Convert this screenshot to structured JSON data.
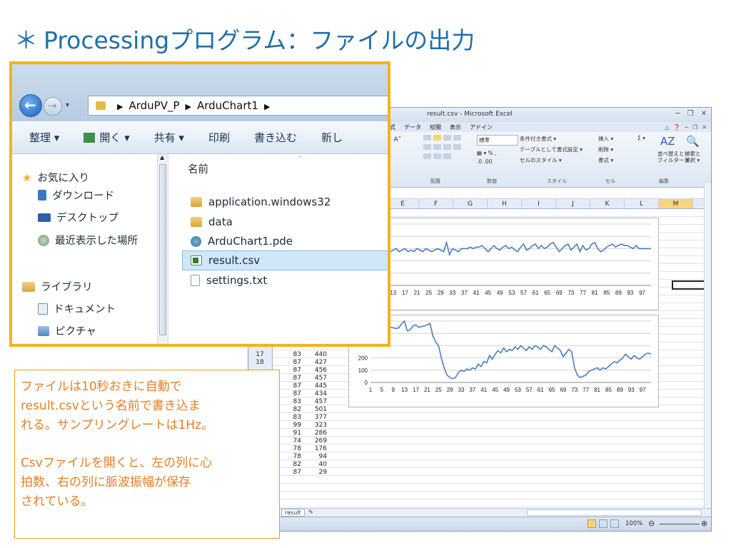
{
  "slide": {
    "title_prefix": "＊",
    "title": "Processingプログラム：ファイルの出力"
  },
  "explorer": {
    "breadcrumb": [
      "ArduPV_P",
      "ArduChart1"
    ],
    "toolbar": [
      "整理 ▾",
      "開く ▾",
      "共有 ▾",
      "印刷",
      "書き込む",
      "新し"
    ],
    "nav": {
      "favorites": "お気に入り",
      "downloads": "ダウンロード",
      "desktop": "デスクトップ",
      "recent": "最近表示した場所",
      "libraries": "ライブラリ",
      "documents": "ドキュメント",
      "pictures": "ピクチャ"
    },
    "column_header": "名前",
    "files": [
      {
        "name": "application.windows32",
        "icon": "folder-icon"
      },
      {
        "name": "data",
        "icon": "folder-icon"
      },
      {
        "name": "ArduChart1.pde",
        "icon": "processing-file-icon"
      },
      {
        "name": "result.csv",
        "icon": "csv-file-icon",
        "selected": true
      },
      {
        "name": "settings.txt",
        "icon": "text-file-icon"
      }
    ]
  },
  "excel": {
    "caption": "result.csv - Microsoft Excel",
    "tabs": [
      "数式",
      "データ",
      "校閲",
      "表示",
      "アドイン"
    ],
    "ribbon": {
      "number_format": "標準",
      "cond_format": "条件付き書式 ▾",
      "table_format": "テーブルとして書式設定 ▾",
      "cell_style": "セルのスタイル ▾",
      "insert": "挿入 ▾",
      "delete": "削除 ▾",
      "format": "書式 ▾",
      "sort": "並べ替えと\nフィルター ▾",
      "find": "検索と\n選択 ▾",
      "groups": [
        "配置",
        "数値",
        "スタイル",
        "セル",
        "編集"
      ]
    },
    "columns": [
      "E",
      "F",
      "G",
      "H",
      "I",
      "J",
      "K",
      "L",
      "M"
    ],
    "rows": [
      {
        "n": "17",
        "a": "83",
        "b": "440"
      },
      {
        "n": "18",
        "a": "87",
        "b": "427"
      },
      {
        "n": "",
        "a": "87",
        "b": "456"
      },
      {
        "n": "",
        "a": "87",
        "b": "457"
      },
      {
        "n": "",
        "a": "87",
        "b": "445"
      },
      {
        "n": "",
        "a": "87",
        "b": "434"
      },
      {
        "n": "",
        "a": "83",
        "b": "457"
      },
      {
        "n": "",
        "a": "82",
        "b": "501"
      },
      {
        "n": "",
        "a": "83",
        "b": "377"
      },
      {
        "n": "",
        "a": "99",
        "b": "323"
      },
      {
        "n": "",
        "a": "91",
        "b": "286"
      },
      {
        "n": "",
        "a": "74",
        "b": "269"
      },
      {
        "n": "",
        "a": "78",
        "b": "176"
      },
      {
        "n": "",
        "a": "78",
        "b": "94"
      },
      {
        "n": "",
        "a": "82",
        "b": "40"
      },
      {
        "n": "",
        "a": "87",
        "b": "29"
      }
    ],
    "sheet_tab": "result",
    "zoom": "100%",
    "chart_xticks": [
      "1",
      "5",
      "9",
      "13",
      "17",
      "21",
      "25",
      "29",
      "33",
      "37",
      "41",
      "45",
      "49",
      "53",
      "57",
      "61",
      "65",
      "69",
      "73",
      "77",
      "81",
      "85",
      "89",
      "93",
      "97"
    ],
    "chart_xticks_top": [
      "9",
      "13",
      "17",
      "21",
      "25",
      "29",
      "33",
      "37",
      "41",
      "45",
      "49",
      "53",
      "57",
      "61",
      "65",
      "69",
      "73",
      "77",
      "81",
      "85",
      "89",
      "93",
      "97"
    ],
    "chart2_yticks": [
      "0",
      "100",
      "200"
    ]
  },
  "chart_data": [
    {
      "type": "line",
      "x": [
        1,
        2,
        3,
        4,
        5,
        6,
        7,
        8,
        9,
        10,
        11,
        12,
        13,
        14,
        15,
        16,
        17,
        18,
        19,
        20,
        21,
        22,
        23,
        24,
        25,
        26,
        27,
        28,
        29,
        30,
        31,
        32,
        33,
        34,
        35,
        36,
        37,
        38,
        39,
        40,
        41,
        42,
        43,
        44,
        45,
        46,
        47,
        48,
        49,
        50,
        51,
        52,
        53,
        54,
        55,
        56,
        57,
        58,
        59,
        60,
        61,
        62,
        63,
        64,
        65,
        66,
        67,
        68,
        69,
        70,
        71,
        72,
        73,
        74,
        75,
        76,
        77,
        78,
        79,
        80,
        81,
        82,
        83,
        84,
        85,
        86,
        87,
        88,
        89,
        90,
        91,
        92,
        93,
        94,
        95,
        96,
        97,
        98,
        99,
        100
      ],
      "values": [
        82,
        83,
        84,
        82,
        84,
        83,
        82,
        84,
        83,
        82,
        81,
        82,
        83,
        84,
        82,
        83,
        84,
        82,
        83,
        82,
        84,
        83,
        82,
        84,
        83,
        82,
        83,
        84,
        83,
        82,
        88,
        80,
        84,
        83,
        82,
        84,
        84,
        84,
        85,
        84,
        85,
        85,
        86,
        84,
        82,
        84,
        86,
        84,
        83,
        85,
        86,
        84,
        85,
        83,
        82,
        85,
        87,
        83,
        84,
        86,
        87,
        84,
        86,
        84,
        85,
        87,
        88,
        85,
        82,
        84,
        86,
        87,
        83,
        85,
        87,
        82,
        86,
        83,
        84,
        87,
        88,
        84,
        82,
        83,
        85,
        86,
        87,
        85,
        86,
        87,
        86,
        86,
        85,
        84,
        86,
        84,
        84,
        84,
        84,
        84
      ],
      "xlabel": "",
      "ylabel": ""
    },
    {
      "type": "line",
      "x": [
        1,
        2,
        3,
        4,
        5,
        6,
        7,
        8,
        9,
        10,
        11,
        12,
        13,
        14,
        15,
        16,
        17,
        18,
        19,
        20,
        21,
        22,
        23,
        24,
        25,
        26,
        27,
        28,
        29,
        30,
        31,
        32,
        33,
        34,
        35,
        36,
        37,
        38,
        39,
        40,
        41,
        42,
        43,
        44,
        45,
        46,
        47,
        48,
        49,
        50,
        51,
        52,
        53,
        54,
        55,
        56,
        57,
        58,
        59,
        60,
        61,
        62,
        63,
        64,
        65,
        66,
        67,
        68,
        69,
        70,
        71,
        72,
        73,
        74,
        75,
        76,
        77,
        78,
        79,
        80,
        81,
        82,
        83,
        84,
        85,
        86,
        87,
        88,
        89,
        90,
        91,
        92,
        93,
        94,
        95,
        96,
        97,
        98,
        99,
        100
      ],
      "values": [
        520,
        500,
        480,
        510,
        440,
        430,
        440,
        450,
        445,
        440,
        445,
        480,
        500,
        420,
        430,
        460,
        470,
        450,
        455,
        460,
        470,
        480,
        380,
        330,
        300,
        200,
        120,
        60,
        40,
        30,
        40,
        80,
        100,
        90,
        110,
        100,
        120,
        110,
        150,
        130,
        170,
        160,
        220,
        190,
        230,
        260,
        240,
        280,
        250,
        270,
        260,
        290,
        270,
        300,
        280,
        260,
        290,
        270,
        300,
        290,
        270,
        300,
        290,
        270,
        250,
        300,
        280,
        260,
        210,
        240,
        270,
        250,
        120,
        60,
        40,
        50,
        60,
        90,
        100,
        110,
        120,
        100,
        120,
        110,
        130,
        150,
        170,
        160,
        180,
        200,
        230,
        210,
        190,
        220,
        200,
        190,
        210,
        230,
        240,
        230
      ],
      "yticks": [
        0,
        100,
        200
      ],
      "xlabel": "",
      "ylabel": ""
    }
  ],
  "note": {
    "para1": "ファイルは10秒おきに自動で\nresult.csvという名前で書き込ま\nれる。サンプリングレートは1Hz。",
    "para2": "Csvファイルを開くと、左の列に心\n拍数、右の列に脈波振幅が保存\nされている。"
  }
}
